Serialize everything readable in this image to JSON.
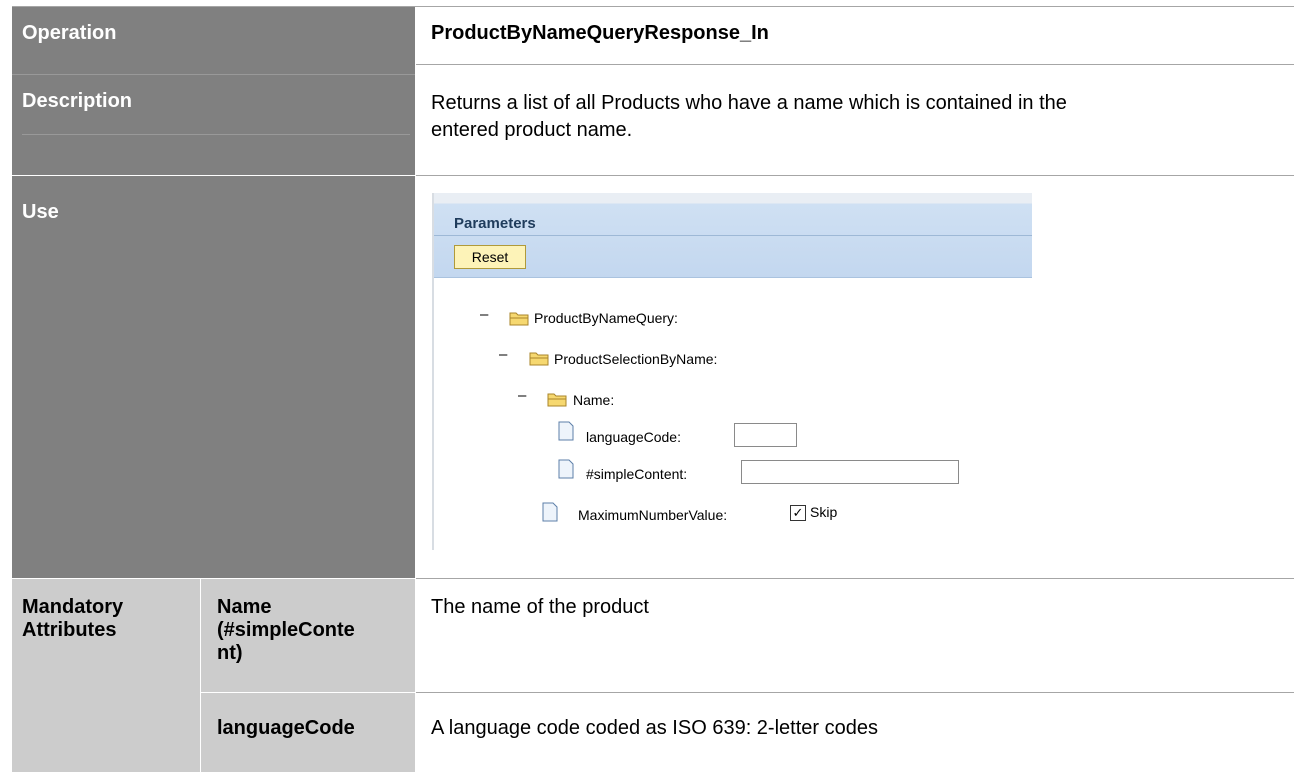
{
  "rows": {
    "operation": {
      "label": "Operation",
      "value": "ProductByNameQueryResponse_In"
    },
    "description": {
      "label": "Description",
      "value_line1": "Returns a list of all Products who have a name which is contained in the",
      "value_line2": "entered product name."
    },
    "use": {
      "label": "Use"
    },
    "mandatory": {
      "label_line1": "Mandatory",
      "label_line2": "Attributes",
      "attributes": [
        {
          "name_line1": "Name",
          "name_line2": "(#simpleConte",
          "name_line3": "nt)",
          "description": "The name of the product"
        },
        {
          "name_line1": "languageCode",
          "description": "A language code coded as ISO 639: 2-letter codes"
        }
      ]
    }
  },
  "parameters_panel": {
    "title": "Parameters",
    "reset_label": "Reset",
    "tree": {
      "node1": "ProductByNameQuery:",
      "node2": "ProductSelectionByName:",
      "node3": "Name:",
      "leaf_language": "languageCode:",
      "leaf_simple": "#simpleContent:",
      "leaf_max": "MaximumNumberValue:",
      "skip_label": "Skip",
      "skip_checked": true,
      "language_value": "",
      "simple_value": "",
      "minus_glyph": "–"
    },
    "icons": [
      "folder-icon",
      "document-icon",
      "checkbox-icon"
    ],
    "colors": {
      "header": "#c3d7ef",
      "reset_button": "#fdf3b8",
      "folder": "#f2c94c"
    }
  },
  "colors": {
    "label_dark": "#808080",
    "label_light": "#cccccc",
    "border": "#a6a6a6"
  }
}
